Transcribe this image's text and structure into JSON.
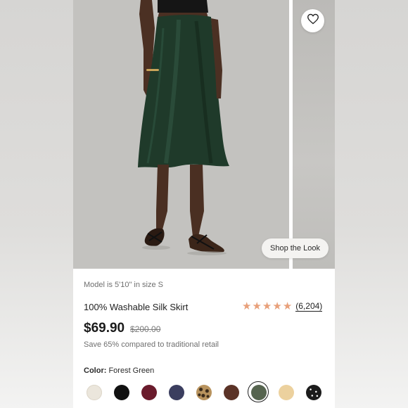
{
  "product": {
    "model_note": "Model is 5'10\" in size S",
    "title": "100% Washable Silk Skirt",
    "rating_value": 5,
    "review_count": "(6,204)",
    "price": "$69.90",
    "original_price": "$200.00",
    "savings_text": "Save 65% compared to traditional retail",
    "color_label": "Color:",
    "color_value": "Forest Green"
  },
  "gallery": {
    "shop_the_look_label": "Shop the Look",
    "favorite_icon": "heart-icon"
  },
  "swatches": [
    {
      "name": "ivory",
      "color": "#ebe6dc",
      "pattern": "solid",
      "selected": false
    },
    {
      "name": "black",
      "color": "#111111",
      "pattern": "solid",
      "selected": false
    },
    {
      "name": "burgundy",
      "color": "#6a1b2c",
      "pattern": "solid",
      "selected": false
    },
    {
      "name": "navy",
      "color": "#3b3e5f",
      "pattern": "solid",
      "selected": false
    },
    {
      "name": "leopard",
      "color": "#b8935e",
      "pattern": "leopard",
      "selected": false
    },
    {
      "name": "brown",
      "color": "#5b3327",
      "pattern": "solid",
      "selected": false
    },
    {
      "name": "forest-green",
      "color": "#56644f",
      "pattern": "solid",
      "selected": true
    },
    {
      "name": "sand",
      "color": "#ecd19e",
      "pattern": "solid",
      "selected": false
    },
    {
      "name": "black-dot",
      "color": "#1c1c1c",
      "pattern": "dots",
      "selected": false
    }
  ],
  "colors": {
    "star": "#e8a07a",
    "skirt": "#1f3a2a"
  }
}
